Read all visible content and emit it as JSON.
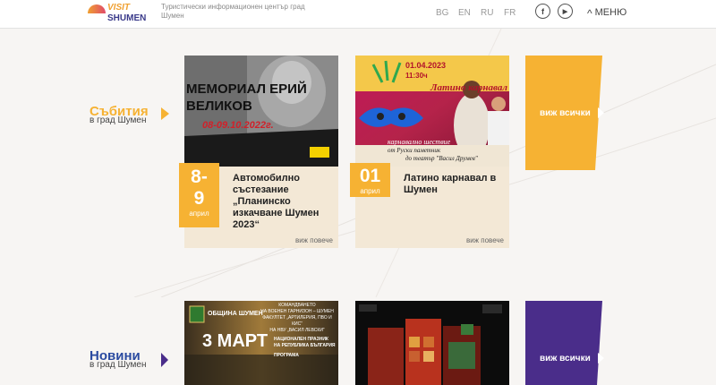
{
  "header": {
    "logo_top": "VISIT",
    "logo_bottom": "SHUMEN",
    "tagline": "Туристически информационен център град Шумен",
    "languages": [
      "BG",
      "EN",
      "RU",
      "FR"
    ],
    "facebook_glyph": "f",
    "youtube_glyph": "▶",
    "menu_label": "МЕНЮ"
  },
  "events": {
    "title": "Събития",
    "subtitle": "в град Шумен",
    "see_all": "виж всички",
    "cards": [
      {
        "day_line1": "8-",
        "day_line2": "9",
        "month": "април",
        "title": "Автомобилно състезание „Планинско изкачване Шумен 2023“",
        "more": "виж повече",
        "img_text": "МЕМОРИАЛ ЕРИЙ ВЕЛИКОВ",
        "img_date": "08-09.10.2022г."
      },
      {
        "day_line1": "01",
        "month": "април",
        "title": "Латино карнавал в Шумен",
        "more": "виж повече",
        "img_date": "01.04.2023",
        "img_time": "11:30ч",
        "img_title": "Латино карнавал",
        "img_sub1": "карнавално шествие",
        "img_sub2": "от Руски паметник",
        "img_sub3": "до театър \"Васил Друмев\""
      }
    ]
  },
  "news": {
    "title": "Новини",
    "subtitle": "в град Шумен",
    "see_all": "виж всички",
    "card1": {
      "municipality": "ОБЩИНА ШУМЕН",
      "big": "3 МАРТ",
      "line1": "КОМАНДВАНЕТО",
      "line2": "НА ВОЕНЕН ГАРНИЗОН – ШУМЕН",
      "line3": "ФАКУЛТЕТ „АРТИЛЕРИЯ, ПВО И КИС“",
      "line4": "НА НВУ „ВАСИЛ ЛЕВСКИ“",
      "line5": "НАЦИОНАЛЕН ПРАЗНИК",
      "line6": "НА РЕПУБЛИКА БЪЛГАРИЯ",
      "line7": "ПРОГРАМА"
    }
  },
  "colors": {
    "yellow": "#f6b233",
    "purple": "#4a2d8a",
    "blue_title": "#2a4aa0"
  }
}
